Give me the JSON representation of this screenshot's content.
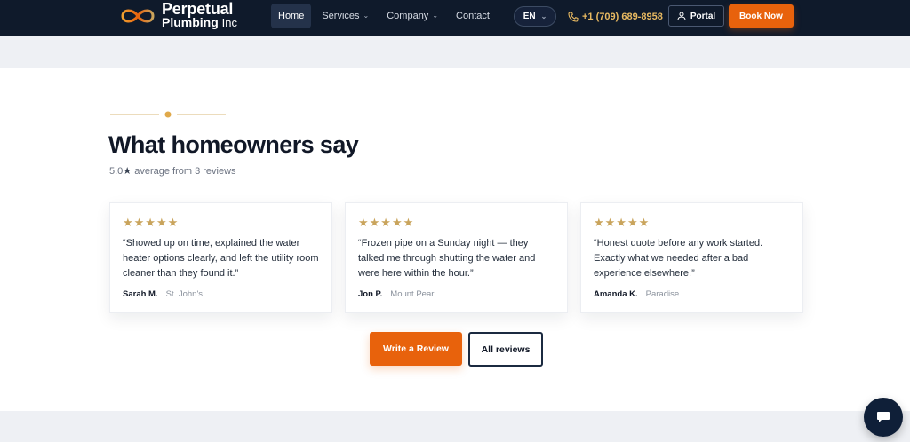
{
  "header": {
    "brand_line1": "Perpetual",
    "brand_line2": "Plumbing",
    "brand_suffix": "Inc",
    "nav": [
      {
        "label": "Home",
        "active": true
      },
      {
        "label": "Services",
        "dropdown": true
      },
      {
        "label": "Company",
        "dropdown": true
      },
      {
        "label": "Contact"
      }
    ],
    "language": "EN",
    "phone": "+1 (709) 689-8958",
    "portal_label": "Portal",
    "book_label": "Book Now"
  },
  "reviews_section": {
    "title": "What homeowners say",
    "rating_value": "5.0",
    "rating_star": "★",
    "rating_text": "average from 3 reviews",
    "reviews": [
      {
        "stars": "★★★★★",
        "rating": 5,
        "quote": "“Showed up on time, explained the water heater options clearly, and left the utility room cleaner than they found it.”",
        "name": "Sarah M.",
        "place": "St. John's"
      },
      {
        "stars": "★★★★★",
        "rating": 5,
        "quote": "“Frozen pipe on a Sunday night — they talked me through shutting the water and were here within the hour.”",
        "name": "Jon P.",
        "place": "Mount Pearl"
      },
      {
        "stars": "★★★★★",
        "rating": 5,
        "quote": "“Honest quote before any work started. Exactly what we needed after a bad experience elsewhere.”",
        "name": "Amanda K.",
        "place": "Paradise"
      }
    ],
    "write_review_label": "Write a Review",
    "all_reviews_label": "All reviews"
  },
  "colors": {
    "header_bg": "#0f1a2b",
    "accent_orange": "#e8620c",
    "gold": "#c9a45c",
    "phone_gold": "#e8b961"
  },
  "icons": {
    "logo": "infinity-logo-icon",
    "phone": "phone-icon",
    "portal": "user-icon",
    "chat": "chat-bubble-icon"
  }
}
